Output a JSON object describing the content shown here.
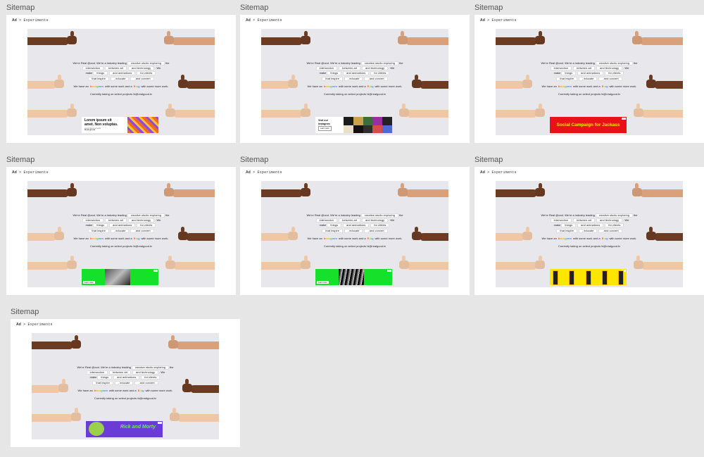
{
  "frames": [
    {
      "label": "Sitemap",
      "breadcrumb_strong": "Ad",
      "breadcrumb_rest": "> Experiments",
      "ad_kind": "lorem",
      "ad": {
        "headline": "Lorem ipsum sit amet. Non voluptas.",
        "sub": "Lorem ipsum et dolor",
        "brand": "Real @ood."
      }
    },
    {
      "label": "Sitemap",
      "breadcrumb_strong": "Ad",
      "breadcrumb_rest": "> Experiments",
      "ad_kind": "instagram",
      "ad": {
        "headline": "Visit our instagram today",
        "button": "Learn more"
      }
    },
    {
      "label": "Sitemap",
      "breadcrumb_strong": "Ad",
      "breadcrumb_rest": "> Experiments",
      "ad_kind": "social",
      "ad": {
        "headline": "Social Campaign for Jackass"
      }
    },
    {
      "label": "Sitemap",
      "breadcrumb_strong": "Ad",
      "breadcrumb_rest": "> Experiments",
      "ad_kind": "green-photo",
      "ad": {
        "button": "Learn more"
      }
    },
    {
      "label": "Sitemap",
      "breadcrumb_strong": "Ad",
      "breadcrumb_rest": "> Experiments",
      "ad_kind": "green-text",
      "ad": {
        "button": "Learn more"
      }
    },
    {
      "label": "Sitemap",
      "breadcrumb_strong": "Ad",
      "breadcrumb_rest": "> Experiments",
      "ad_kind": "yellow-phones",
      "ad": {}
    },
    {
      "label": "Sitemap",
      "breadcrumb_strong": "Ad",
      "breadcrumb_rest": "> Experiments",
      "ad_kind": "rick",
      "ad": {
        "headline": "Rick and Morty"
      }
    }
  ],
  "copy": {
    "line1a": "We're Real @ood. We're a industry leading",
    "line1b": "creative studio exploring",
    "line1c": "the",
    "line2a": "intersection",
    "line2b": "between art",
    "line2c": "and technology",
    "line2d": ". We",
    "line3a": "make",
    "line3b": "things",
    "line3c": "and animations",
    "line3d": "for clients",
    "line4a": "that inspire",
    "line4b": ", educate",
    "line4c": ", and convert",
    "line5a": "We have an",
    "line5b": "Instagram",
    "line5c": "with some work and a",
    "line5d": "Blog",
    "line5e": "with some more work.",
    "line6": "Currently taking on select projects hi@realgood.tv"
  },
  "colors": {
    "canvas": "#e6e6e6",
    "frame": "#ffffff",
    "stage": "#e8e8ec",
    "skin_dark": "#6b3b22",
    "skin_light": "#f0c7a6",
    "skin_mid": "#d9a07a",
    "ad_green": "#16e02a",
    "ad_red": "#e8111a",
    "ad_yellow": "#ffe600",
    "ad_purple": "#6a3bd6"
  }
}
